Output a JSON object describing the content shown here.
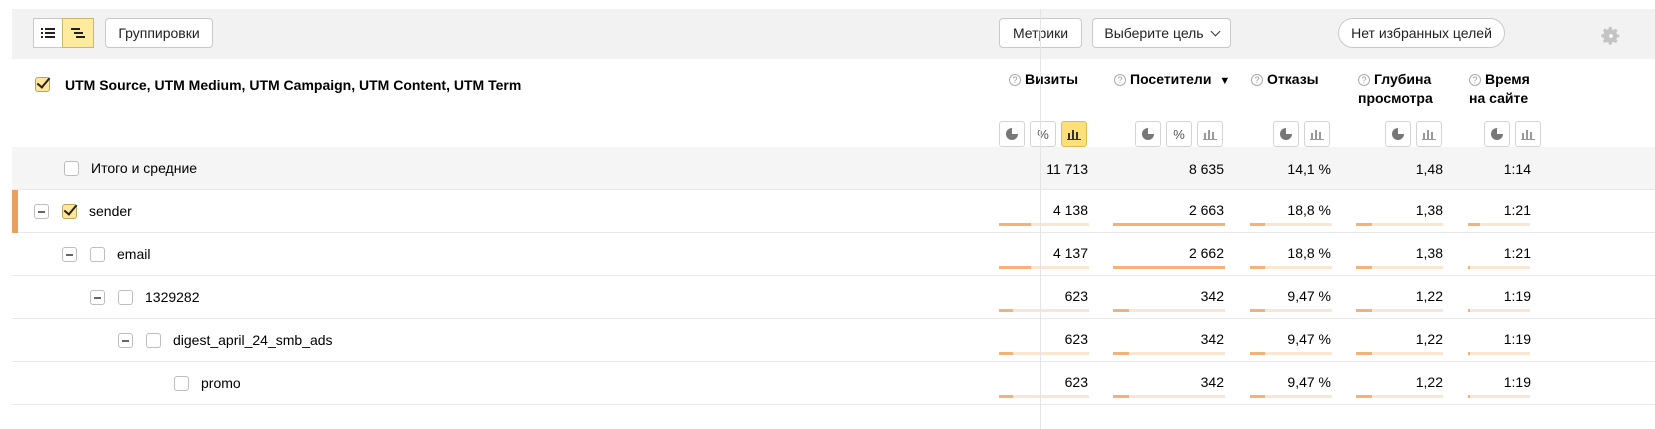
{
  "toolbar": {
    "groupings_label": "Группировки",
    "metrics_label": "Метрики",
    "goal_select_label": "Выберите цель",
    "favorites_label": "Нет избранных целей",
    "icons": [
      "list-view-icon",
      "tree-view-icon",
      "gear-icon"
    ]
  },
  "header": {
    "dimension_title": "UTM Source, UTM Medium, UTM Campaign, UTM Content, UTM Term",
    "columns": [
      {
        "line1": "Визиты",
        "line2": ""
      },
      {
        "line1": "Посетители",
        "line2": "",
        "sort": "▼"
      },
      {
        "line1": "Отказы",
        "line2": ""
      },
      {
        "line1": "Глубина",
        "line2": "просмотра"
      },
      {
        "line1": "Время",
        "line2": "на сайте"
      }
    ],
    "help_glyph": "?",
    "percent_glyph": "%"
  },
  "rows": [
    {
      "label": "Итого и средние",
      "total": true,
      "values": [
        "11 713",
        "8 635",
        "14,1 %",
        "1,48",
        "1:14"
      ]
    },
    {
      "label": "sender",
      "checked": true,
      "values": [
        "4 138",
        "2 663",
        "18,8 %",
        "1,38",
        "1:21"
      ],
      "fills": [
        0.35,
        1.0,
        0.18,
        0.18,
        0.2
      ]
    },
    {
      "label": "email",
      "values": [
        "4 137",
        "2 662",
        "18,8 %",
        "1,38",
        "1:21"
      ],
      "fills": [
        0.35,
        1.0,
        0.18,
        0.18,
        0.04
      ]
    },
    {
      "label": "1329282",
      "values": [
        "623",
        "342",
        "9,47 %",
        "1,22",
        "1:19"
      ],
      "fills": [
        0.15,
        0.14,
        0.18,
        0.18,
        0.04
      ]
    },
    {
      "label": "digest_april_24_smb_ads",
      "values": [
        "623",
        "342",
        "9,47 %",
        "1,22",
        "1:19"
      ],
      "fills": [
        0.15,
        0.14,
        0.18,
        0.18,
        0.04
      ]
    },
    {
      "label": "promo",
      "values": [
        "623",
        "342",
        "9,47 %",
        "1,22",
        "1:19"
      ],
      "fills": [
        0.15,
        0.14,
        0.18,
        0.18,
        0.04
      ]
    }
  ],
  "colors": {
    "accent": "#e8a060",
    "bar_fill": "#f3b27a",
    "bar_track": "#fbe5d3",
    "active_button": "#ffdf7a"
  }
}
